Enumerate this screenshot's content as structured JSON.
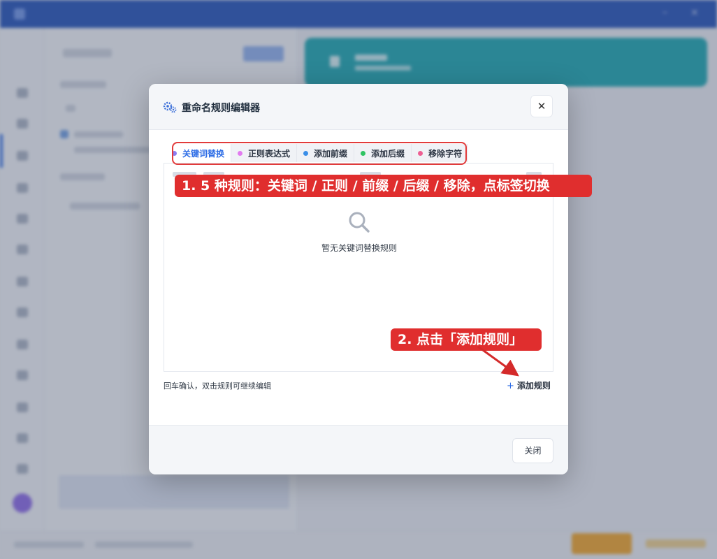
{
  "dialog": {
    "title": "重命名规则编辑器",
    "icon": "gears-icon",
    "close_icon": "close-icon",
    "tabs": [
      {
        "label": "关键词替换",
        "dot_color": "#a78bfa",
        "active": true
      },
      {
        "label": "正则表达式",
        "dot_color": "#e879f9",
        "active": false
      },
      {
        "label": "添加前缀",
        "dot_color": "#3b82f6",
        "active": false
      },
      {
        "label": "添加后缀",
        "dot_color": "#22c55e",
        "active": false
      },
      {
        "label": "移除字符",
        "dot_color": "#f472b6",
        "active": false
      }
    ],
    "empty_icon": "search-icon",
    "empty_text": "暂无关键词替换规则",
    "hint": "回车确认，双击规则可继续编辑",
    "add_rule_label": "添加规则",
    "close_button": "关闭"
  },
  "annotations": {
    "callout_1": "1. 5 种规则：关键词 / 正则 / 前缀 / 后缀 / 移除，点标签切换",
    "callout_2": "2. 点击「添加规则」"
  },
  "colors": {
    "accent": "#2f6ee6",
    "annotation": "#e02e2e",
    "titlebar": "#1f4fb8",
    "banner": "#17a7b0"
  }
}
